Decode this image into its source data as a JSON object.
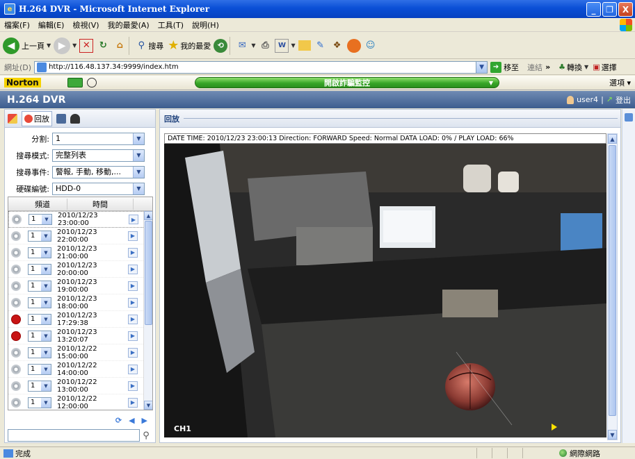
{
  "window": {
    "title": "H.264 DVR - Microsoft Internet Explorer",
    "controls": {
      "minimize": "_",
      "restore": "❐",
      "close": "X"
    }
  },
  "menu": [
    "檔案(F)",
    "編輯(E)",
    "檢視(V)",
    "我的最愛(A)",
    "工具(T)",
    "說明(H)"
  ],
  "toolbar": {
    "back": "上一頁",
    "search": "搜尋",
    "favorites": "我的最愛"
  },
  "address": {
    "label": "網址(D)",
    "url": "http://116.48.137.34:9999/index.htm",
    "go": "移至",
    "links": "連結",
    "convert": "轉換",
    "select": "選擇"
  },
  "norton": {
    "logo": "Norton",
    "phishing": "開啟詐騙監控",
    "options": "選項"
  },
  "dvr": {
    "brand": "H.264 DVR",
    "user": "user4",
    "logout": "登出",
    "tab_playback": "回放"
  },
  "form": {
    "split_label": "分割:",
    "split_value": "1",
    "mode_label": "搜尋模式:",
    "mode_value": "完整列表",
    "event_label": "搜尋事件:",
    "event_value": "警報, 手動, 移動,...",
    "hdd_label": "硬碟編號:",
    "hdd_value": "HDD-0"
  },
  "list": {
    "col_channel": "頻道",
    "col_time": "時間",
    "rows": [
      {
        "type": "sched",
        "ch": "1",
        "time": "2010/12/23 23:00:00"
      },
      {
        "type": "sched",
        "ch": "1",
        "time": "2010/12/23 22:00:00"
      },
      {
        "type": "sched",
        "ch": "1",
        "time": "2010/12/23 21:00:00"
      },
      {
        "type": "sched",
        "ch": "1",
        "time": "2010/12/23 20:00:00"
      },
      {
        "type": "sched",
        "ch": "1",
        "time": "2010/12/23 19:00:00"
      },
      {
        "type": "sched",
        "ch": "1",
        "time": "2010/12/23 18:00:00"
      },
      {
        "type": "alarm",
        "ch": "1",
        "time": "2010/12/23 17:29:38"
      },
      {
        "type": "alarm",
        "ch": "1",
        "time": "2010/12/23 13:20:07"
      },
      {
        "type": "sched",
        "ch": "1",
        "time": "2010/12/22 15:00:00"
      },
      {
        "type": "sched",
        "ch": "1",
        "time": "2010/12/22 14:00:00"
      },
      {
        "type": "sched",
        "ch": "1",
        "time": "2010/12/22 13:00:00"
      },
      {
        "type": "sched",
        "ch": "1",
        "time": "2010/12/22 12:00:00"
      }
    ]
  },
  "playback": {
    "header": "回放",
    "info": "DATE TIME: 2010/12/23 23:00:13   Direction: FORWARD  Speed: Normal  DATA LOAD: 0% / PLAY LOAD: 66%",
    "camera": "CH1"
  },
  "status": {
    "text": "完成",
    "zone": "網際網路"
  }
}
